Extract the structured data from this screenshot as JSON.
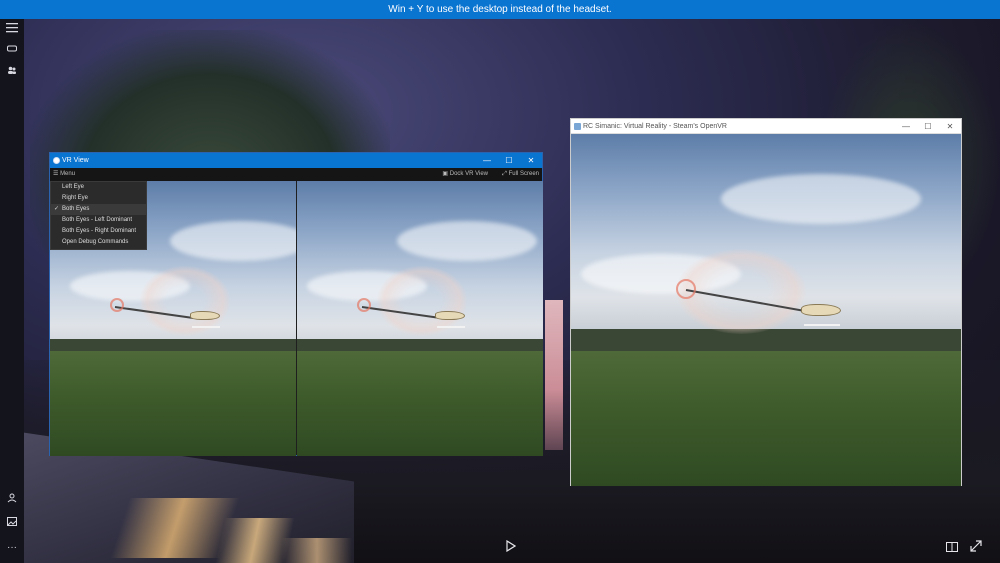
{
  "banner": {
    "text": "Win + Y to use the desktop instead of the headset."
  },
  "sidebar": {
    "top_icons": [
      "menu-icon",
      "headset-icon",
      "people-icon"
    ],
    "bottom_icons": [
      "person-add-icon",
      "photo-icon",
      "more-icon"
    ],
    "more_glyph": "···"
  },
  "vr_view": {
    "title": "VR View",
    "toolbar": {
      "menu_label": "Menu",
      "dock_label": "Dock VR View",
      "fullscreen_label": "Full Screen"
    },
    "menu": {
      "items": [
        {
          "label": "Left Eye",
          "checked": false
        },
        {
          "label": "Right Eye",
          "checked": false
        },
        {
          "label": "Both Eyes",
          "checked": true
        },
        {
          "label": "Both Eyes - Left Dominant",
          "checked": false
        },
        {
          "label": "Both Eyes - Right Dominant",
          "checked": false
        },
        {
          "label": "Open Debug Commands",
          "checked": false
        }
      ],
      "check_glyph": "✓"
    }
  },
  "game_window": {
    "title": "RC Simanic: Virtual Reality - Steam's OpenVR"
  },
  "window_controls": {
    "minimize": "—",
    "maximize": "☐",
    "close": "✕"
  },
  "bottom_bar": {
    "play_icon": "play-icon",
    "mirror_icon": "panel-icon",
    "expand_icon": "expand-icon"
  }
}
